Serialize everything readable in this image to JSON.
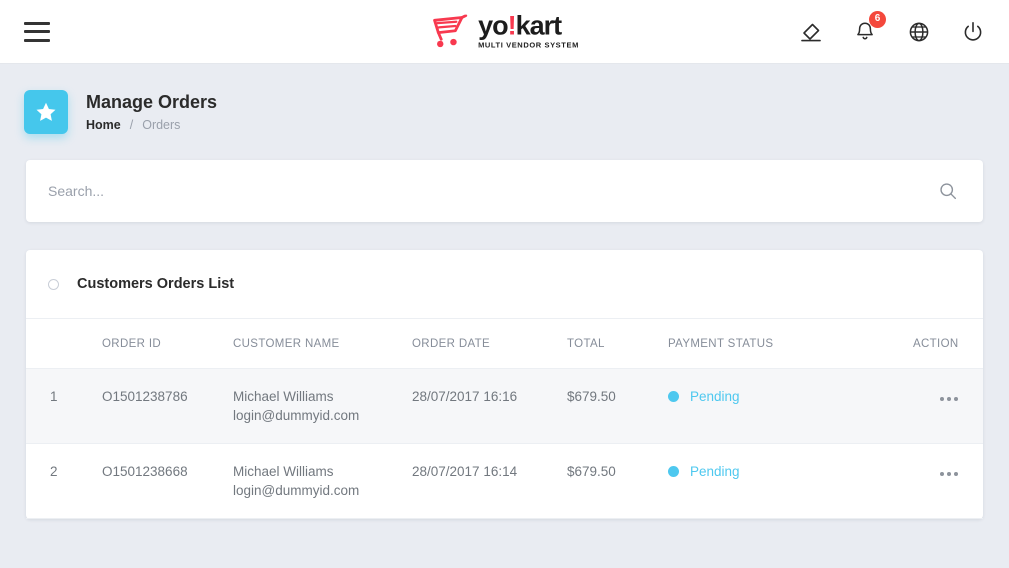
{
  "topbar": {
    "menu_icon": "hamburger-menu-icon",
    "logo": {
      "word_a": "yo",
      "word_bang": "!",
      "word_b": "kart",
      "tagline": "MULTI VENDOR SYSTEM",
      "brand_color": "#f8394f"
    },
    "actions": [
      {
        "name": "clear-cache-icon",
        "label": "Clear Cache"
      },
      {
        "name": "notifications-icon",
        "label": "Notifications",
        "badge": "6",
        "badge_color": "#f4483c"
      },
      {
        "name": "language-icon",
        "label": "Language"
      },
      {
        "name": "power-icon",
        "label": "Logout"
      }
    ]
  },
  "page": {
    "icon": "star-icon",
    "icon_color": "#45c7ec",
    "title": "Manage Orders",
    "breadcrumb": {
      "home": "Home",
      "separator": "/",
      "current": "Orders"
    }
  },
  "search": {
    "placeholder": "Search...",
    "value": "",
    "icon": "search-icon"
  },
  "list": {
    "title": "Customers Orders List",
    "columns": [
      "",
      "ORDER ID",
      "CUSTOMER NAME",
      "ORDER DATE",
      "TOTAL",
      "PAYMENT STATUS",
      "ACTION"
    ],
    "status_color": "#4ec8ef",
    "rows": [
      {
        "index": "1",
        "order_id": "O1501238786",
        "customer_name": "Michael Williams",
        "customer_email": "login@dummyid.com",
        "order_date": "28/07/2017 16:16",
        "total": "$679.50",
        "payment_status": "Pending",
        "action": "more-options"
      },
      {
        "index": "2",
        "order_id": "O1501238668",
        "customer_name": "Michael Williams",
        "customer_email": "login@dummyid.com",
        "order_date": "28/07/2017 16:14",
        "total": "$679.50",
        "payment_status": "Pending",
        "action": "more-options"
      }
    ]
  }
}
